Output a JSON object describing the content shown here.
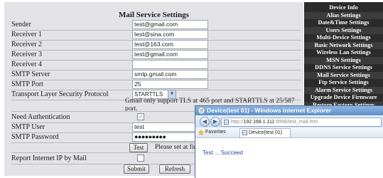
{
  "main": {
    "title": "Mail Service Settings",
    "fields": {
      "sender": {
        "label": "Sender",
        "value": "test@gmail.com"
      },
      "receiver1": {
        "label": "Receiver 1",
        "value": "test@sina.com"
      },
      "receiver2": {
        "label": "Receiver 2",
        "value": "test@163.com"
      },
      "receiver3": {
        "label": "Receiver 3",
        "value": "test@gmail.com"
      },
      "receiver4": {
        "label": "Receiver 4",
        "value": ""
      },
      "smtp_server": {
        "label": "SMTP Server",
        "value": "smtp.gmail.com"
      },
      "smtp_port": {
        "label": "SMTP Port",
        "value": "25"
      },
      "tls": {
        "label": "Transport Layer Security Protocol",
        "value": "STARTTLS"
      },
      "need_auth": {
        "label": "Need Authentication",
        "checked": true
      },
      "smtp_user": {
        "label": "SMTP User",
        "value": "test"
      },
      "smtp_password": {
        "label": "SMTP Password",
        "value": "●●●●●●●●●"
      },
      "report_ip": {
        "label": "Report Internet IP by Mail",
        "checked": false
      }
    },
    "tls_note": "Gmail only support TLS at 465 port and STARTTLS at 25/587 port.",
    "test_button": "Test",
    "test_note": "Please set at firs",
    "submit": "Submit",
    "refresh": "Refresh"
  },
  "menu": {
    "items": [
      "Device Info",
      "Alias Settings",
      "Date&Time Settings",
      "Users Settings",
      "Multi-Device Settings",
      "Basic Network Settings",
      "Wireless Lan Settings",
      "MSN Settings",
      "DDNS Service Settings",
      "Mail Service Settings",
      "Ftp Service Settings",
      "Alarm Service Settings",
      "Upgrade Device Firmware",
      "Restore Factory Settings"
    ]
  },
  "ie": {
    "title": "Device(test 01) - Windows Internet Explorer",
    "url_prefix": "http://",
    "url_host": "192.168.1.111",
    "url_rest": ":9999/test_mail.htm",
    "favorites": "Favorites",
    "tab": "Device(test 01)",
    "result": "Test ... Succeed"
  },
  "colors": {
    "panel_bg": "#e3e2e6",
    "menu_bg": "#2b2b2b",
    "ie_title_bar": "#5f8fc9",
    "result_text": "#2a44a6"
  },
  "icons": [
    "ie-logo-icon",
    "back-icon",
    "forward-icon",
    "page-icon",
    "favorites-star-icon",
    "dropdown-arrow-icon",
    "checkmark-icon"
  ]
}
